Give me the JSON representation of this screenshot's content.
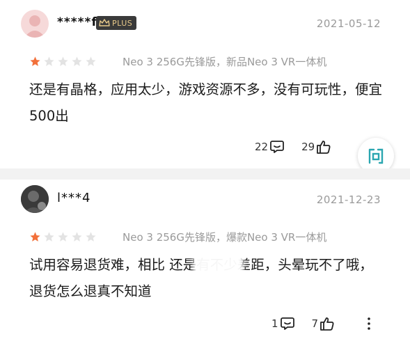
{
  "reviews": [
    {
      "username": "*****f",
      "badge": "PLUS",
      "date": "2021-05-12",
      "rating": 1,
      "variant": "Neo 3 256G先锋版，新品Neo 3 VR一体机",
      "content": "还是有晶格，应用太少，游戏资源不多，没有可玩性，便宜500出",
      "comment_count": "22",
      "like_count": "29"
    },
    {
      "username": "l***4",
      "date": "2021-12-23",
      "rating": 1,
      "variant": "Neo 3 256G先锋版，爆款Neo 3 VR一体机",
      "content": "试用容易退货难，相比        还是有不少差距，头晕玩不了哦，退货怎么退真不知道",
      "comment_count": "1",
      "like_count": "7"
    }
  ],
  "colors": {
    "star_active": "#f2703a",
    "star_inactive": "#e3e3e3",
    "badge_gold": "#e8c98a",
    "float_icon": "#2aa6b0"
  },
  "icons": [
    "crown-icon",
    "star-icon",
    "comment-icon",
    "thumbs-up-icon",
    "more-icon",
    "ask-icon"
  ]
}
